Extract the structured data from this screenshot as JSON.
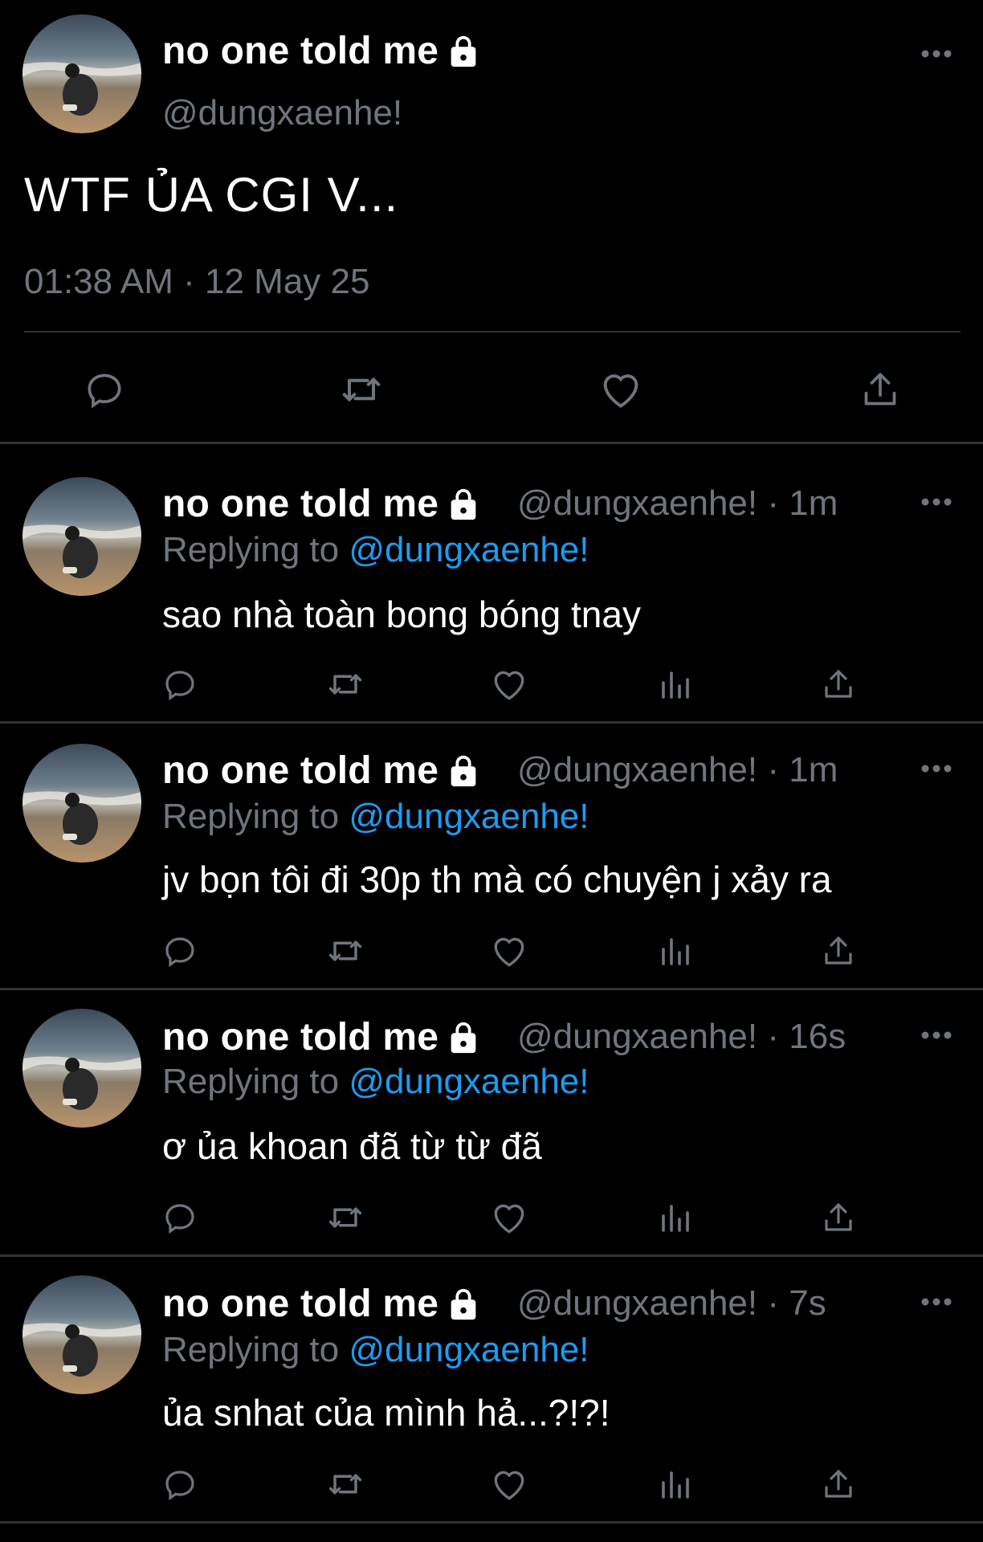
{
  "main_tweet": {
    "display_name": "no one told me",
    "handle": "@dungxaenhe!",
    "text": "WTF ỦA CGI V...",
    "timestamp": "01:38 AM · 12 May 25",
    "lock_icon": "lock-icon",
    "actions": [
      "reply-icon",
      "retweet-icon",
      "like-icon",
      "share-icon"
    ]
  },
  "replies": [
    {
      "display_name": "no one told me",
      "handle": "@dungxaenhe!",
      "time": "1m",
      "replying_prefix": "Replying to ",
      "replying_to": "@dungxaenhe!",
      "text": "sao nhà toàn bong bóng tnay"
    },
    {
      "display_name": "no one told me",
      "handle": "@dungxaenhe!",
      "time": "1m",
      "replying_prefix": "Replying to ",
      "replying_to": "@dungxaenhe!",
      "text": "jv bọn tôi đi 30p th mà có chuyện j xảy ra"
    },
    {
      "display_name": "no one told me",
      "handle": "@dungxaenhe!",
      "time": "16s",
      "replying_prefix": "Replying to ",
      "replying_to": "@dungxaenhe!",
      "text": "ơ ủa khoan đã từ từ đã"
    },
    {
      "display_name": "no one told me",
      "handle": "@dungxaenhe!",
      "time": "7s",
      "replying_prefix": "Replying to ",
      "replying_to": "@dungxaenhe!",
      "text": "ủa snhat của mình hả...?!?!"
    }
  ],
  "colors": {
    "background": "#000000",
    "secondary_text": "#6e767d",
    "accent": "#1d9bf0",
    "divider": "#2f3336"
  }
}
